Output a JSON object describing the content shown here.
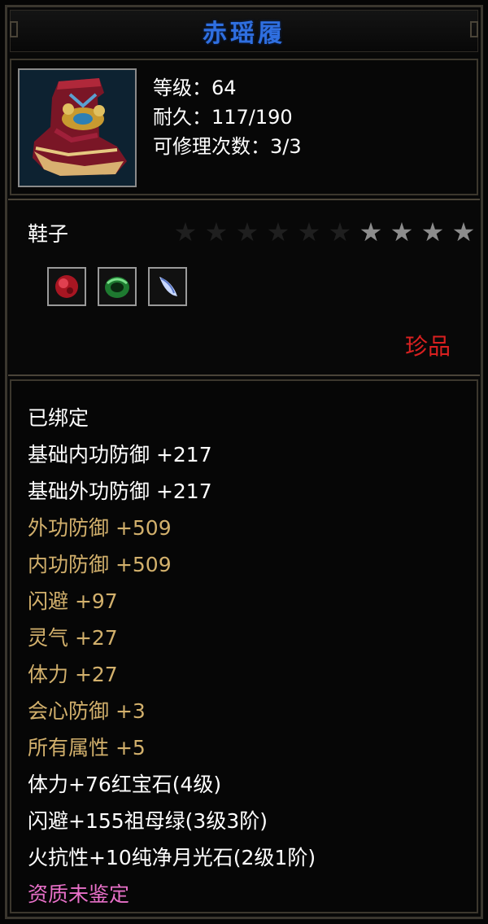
{
  "item": {
    "name": "赤瑶履",
    "level_line": "等级：64",
    "durability_line": "耐久：117/190",
    "repair_line": "可修理次数：3/3",
    "type": "鞋子",
    "quality": "珍品",
    "stars_total": 10,
    "stars_lit": 4
  },
  "gems": [
    {
      "icon": "ruby-gem-icon",
      "color": "#c0202a"
    },
    {
      "icon": "emerald-gem-icon",
      "color": "#2aa040"
    },
    {
      "icon": "moonstone-gem-icon",
      "color": "#c8d8ff"
    }
  ],
  "attributes": [
    {
      "text": "已绑定",
      "color": "white"
    },
    {
      "text": "基础内功防御  +217",
      "color": "white"
    },
    {
      "text": "基础外功防御  +217",
      "color": "white"
    },
    {
      "text": "外功防御  +509",
      "color": "gold"
    },
    {
      "text": "内功防御  +509",
      "color": "gold"
    },
    {
      "text": "闪避  +97",
      "color": "gold"
    },
    {
      "text": "灵气  +27",
      "color": "gold"
    },
    {
      "text": "体力  +27",
      "color": "gold"
    },
    {
      "text": "会心防御  +3",
      "color": "gold"
    },
    {
      "text": "所有属性  +5",
      "color": "gold"
    },
    {
      "text": "体力+76红宝石(4级)",
      "color": "white"
    },
    {
      "text": "闪避+155祖母绿(3级3阶)",
      "color": "white"
    },
    {
      "text": "火抗性+10纯净月光石(2级1阶)",
      "color": "white"
    },
    {
      "text": "资质未鉴定",
      "color": "pink"
    }
  ],
  "colors": {
    "title": "#2f6fe0",
    "quality": "#d92020",
    "gold": "#d2b06c",
    "pink": "#e870c8",
    "star_lit": "#8c8c8c",
    "star_dim": "#1f1f1f"
  }
}
